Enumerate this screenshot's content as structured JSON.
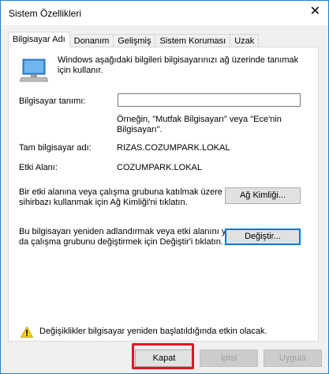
{
  "window": {
    "title": "Sistem Özellikleri",
    "close_glyph": "✕"
  },
  "tabs": [
    {
      "label": "Bilgisayar Adı",
      "active": true
    },
    {
      "label": "Donanım",
      "active": false
    },
    {
      "label": "Gelişmiş",
      "active": false
    },
    {
      "label": "Sistem Koruması",
      "active": false
    },
    {
      "label": "Uzak",
      "active": false
    }
  ],
  "computer_name_tab": {
    "icon": "computer-monitor-icon",
    "description": "Windows aşağıdaki bilgileri bilgisayarınızı ağ üzerinde tanımak için kullanır.",
    "computer_description_label": "Bilgisayar tanımı:",
    "computer_description_value": "",
    "example_text": "Örneğin, \"Mutfak Bilgisayarı\" veya \"Ece'nin Bilgisayarı\".",
    "full_name_label": "Tam bilgisayar adı:",
    "full_name_value": "RIZAS.COZUMPARK.LOKAL",
    "domain_label": "Etki Alanı:",
    "domain_value": "COZUMPARK.LOKAL",
    "network_id_text": "Bir etki alanına veya çalışma grubuna katılmak üzere sihirbazı kullanmak için Ağ Kimliği'ni tıklatın.",
    "network_id_button": "Ağ Kimliği...",
    "rename_text": "Bu bilgisayarı yeniden adlandırmak veya etki alanını ya da çalışma grubunu değiştirmek için Değiştir'i tıklatın.",
    "change_button": "Değiştir...",
    "warning_icon": "warning-icon",
    "warning_text": "Değişiklikler bilgisayar yeniden  başlatıldığında etkin olacak."
  },
  "footer": {
    "close_button": "Kapat",
    "cancel_button": "İptal",
    "apply_button": "Uygula"
  },
  "colors": {
    "window_border": "#1883d7",
    "highlight": "#e81123",
    "focus": "#0078d7"
  }
}
